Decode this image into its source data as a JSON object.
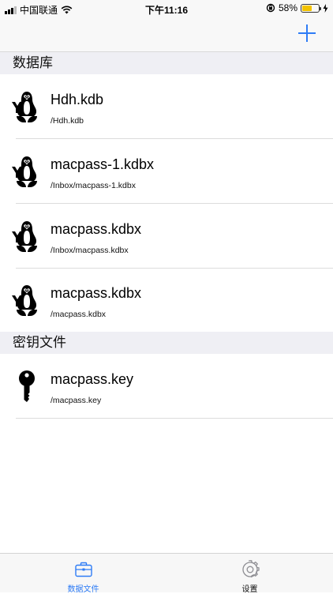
{
  "status_bar": {
    "carrier": "中国联通",
    "time": "下午11:16",
    "battery_percent": "58%",
    "battery_level": 0.58
  },
  "sections": [
    {
      "title": "数据库",
      "items": [
        {
          "name": "Hdh.kdb",
          "path": "/Hdh.kdb",
          "icon": "keepass-penguin-icon"
        },
        {
          "name": "macpass-1.kdbx",
          "path": "/Inbox/macpass-1.kdbx",
          "icon": "keepass-penguin-icon"
        },
        {
          "name": "macpass.kdbx",
          "path": "/Inbox/macpass.kdbx",
          "icon": "keepass-penguin-icon"
        },
        {
          "name": "macpass.kdbx",
          "path": "/macpass.kdbx",
          "icon": "keepass-penguin-icon"
        }
      ]
    },
    {
      "title": "密钥文件",
      "items": [
        {
          "name": "macpass.key",
          "path": "/macpass.key",
          "icon": "key-icon"
        }
      ]
    }
  ],
  "tabs": [
    {
      "label": "数据文件",
      "icon": "briefcase-icon",
      "active": true
    },
    {
      "label": "设置",
      "icon": "gear-icon",
      "active": false
    }
  ],
  "colors": {
    "accent": "#2e7cf6",
    "section_bg": "#efeff4",
    "battery": "#f2c200"
  }
}
